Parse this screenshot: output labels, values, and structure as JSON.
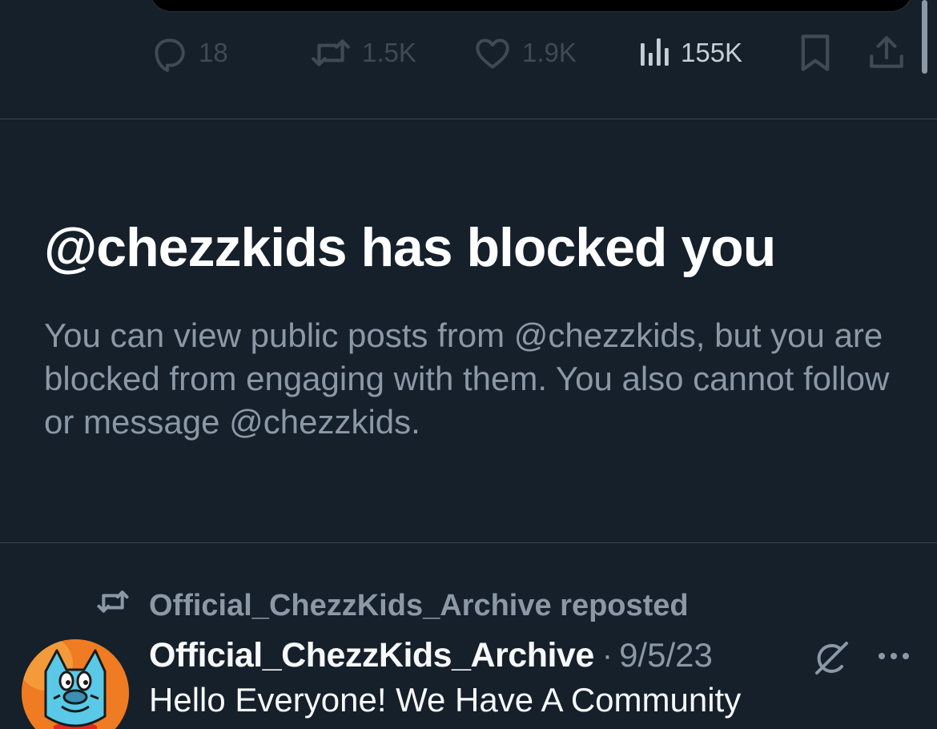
{
  "tweet_actions": {
    "replies": "18",
    "reposts": "1.5K",
    "likes": "1.9K",
    "views": "155K"
  },
  "blocked_notice": {
    "title": "@chezzkids has blocked you",
    "body": "You can view public posts from @chezzkids, but you are blocked from engaging with them. You also cannot follow or message @chezzkids."
  },
  "next_post": {
    "repost_label": "Official_ChezzKids_Archive reposted",
    "author_name": "Official_ChezzKids_Archive",
    "separator": "·",
    "date": "9/5/23",
    "text": "Hello Everyone! We Have A Community"
  },
  "icons": {
    "reply": "reply-icon",
    "repost": "repost-icon",
    "like": "like-icon",
    "views": "views-icon",
    "bookmark": "bookmark-icon",
    "share": "share-icon",
    "grok": "grok-icon",
    "more": "more-icon"
  },
  "colors": {
    "background": "#15202b",
    "primary_text": "#f7f9f9",
    "secondary_text": "#8b98a5",
    "dimmed_icon": "#3f4a55",
    "divider": "#38444d"
  }
}
